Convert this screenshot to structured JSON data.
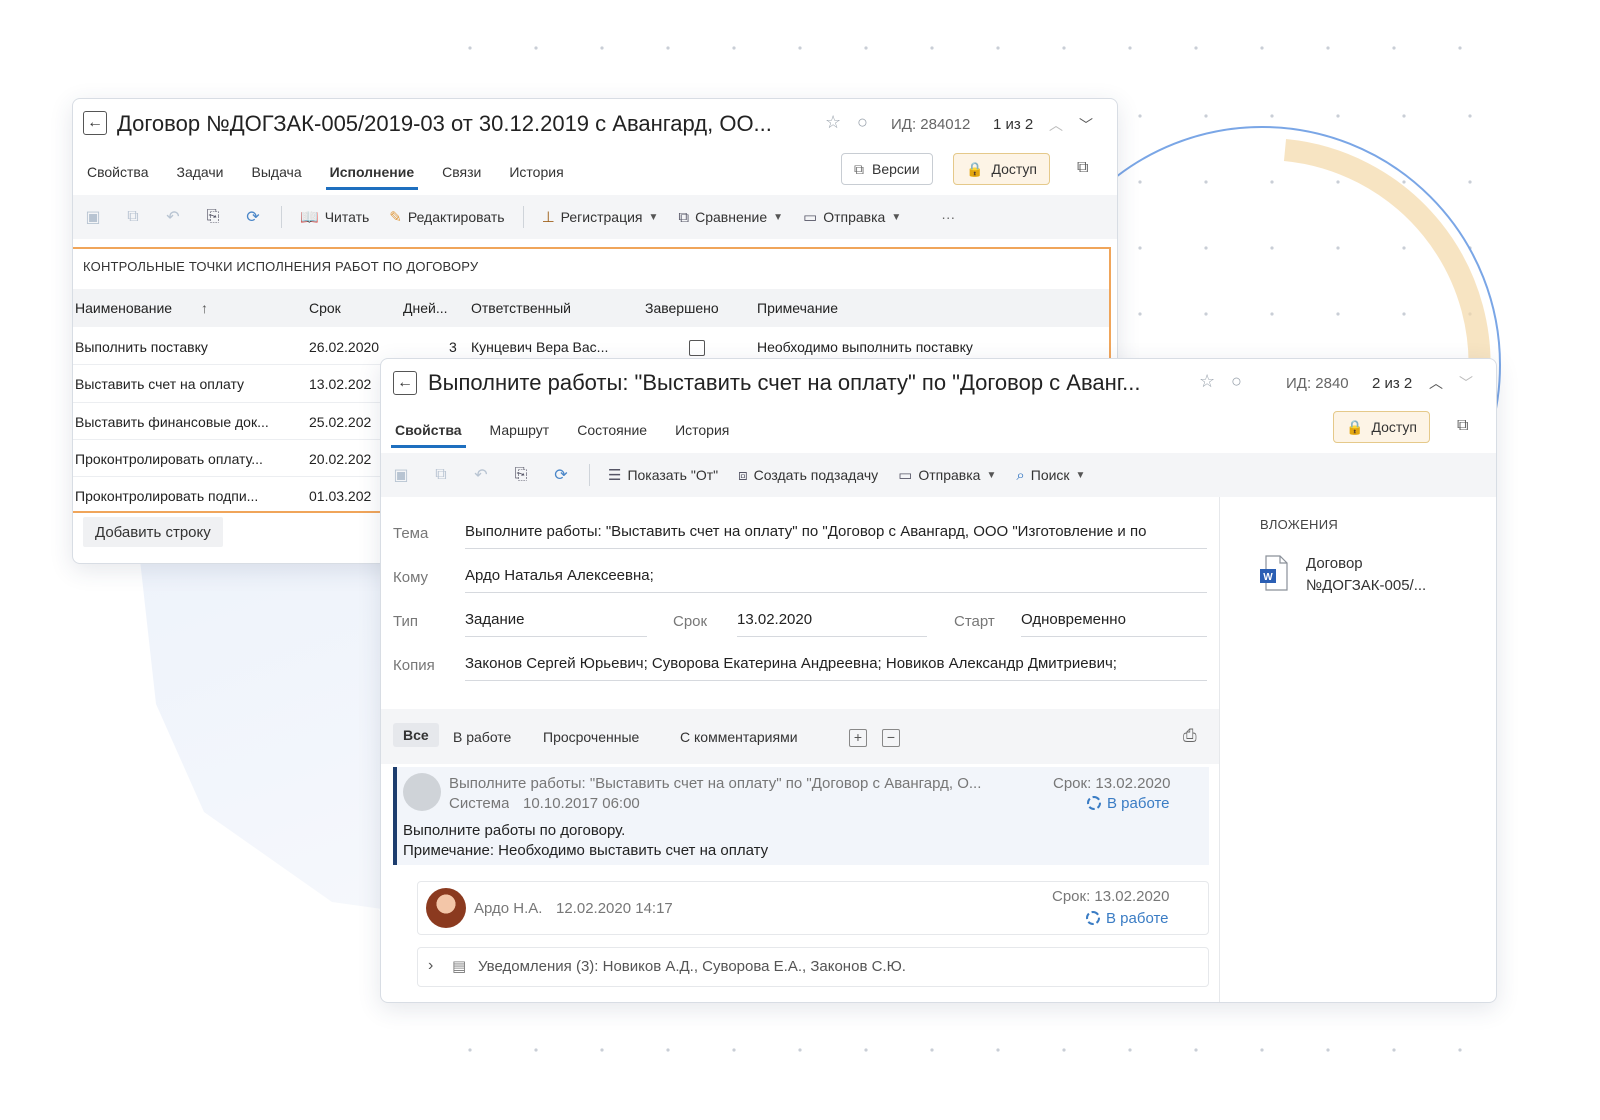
{
  "win1": {
    "title": "Договор №ДОГЗАК-005/2019-03 от 30.12.2019 с Авангард, ОО...",
    "id_text": "ИД: 284012",
    "nav_text": "1 из 2",
    "tabs": [
      "Свойства",
      "Задачи",
      "Выдача",
      "Исполнение",
      "Связи",
      "История"
    ],
    "active_tab": "Исполнение",
    "btn_versions": "Версии",
    "btn_access": "Доступ",
    "toolbar": {
      "read": "Читать",
      "edit": "Редактировать",
      "registration": "Регистрация",
      "comparison": "Сравнение",
      "send": "Отправка",
      "more": "···"
    },
    "section_title": "КОНТРОЛЬНЫЕ ТОЧКИ ИСПОЛНЕНИЯ РАБОТ ПО ДОГОВОРУ",
    "columns": [
      "Наименование",
      "Срок",
      "Дней...",
      "Ответственный",
      "Завершено",
      "Примечание"
    ],
    "sort_indicator": "↑",
    "rows": [
      {
        "name": "Выполнить поставку",
        "date": "26.02.2020",
        "days": "3",
        "responsible": "Кунцевич Вера Вас...",
        "note": "Необходимо выполнить поставку"
      },
      {
        "name": "Выставить счет на оплату",
        "date": "13.02.202"
      },
      {
        "name": "Выставить финансовые док...",
        "date": "25.02.202"
      },
      {
        "name": "Проконтролировать оплату...",
        "date": "20.02.202"
      },
      {
        "name": "Проконтролировать подпи...",
        "date": "01.03.202"
      }
    ],
    "add_row": "Добавить строку"
  },
  "win2": {
    "title": "Выполните работы: \"Выставить счет на оплату\" по \"Договор с Аванг...",
    "id_text": "ИД: 2840",
    "nav_text": "2 из 2",
    "tabs": [
      "Свойства",
      "Маршрут",
      "Состояние",
      "История"
    ],
    "active_tab": "Свойства",
    "btn_access": "Доступ",
    "toolbar": {
      "show_from": "Показать \"От\"",
      "create_subtask": "Создать подзадачу",
      "send": "Отправка",
      "search": "Поиск"
    },
    "fields": {
      "subject_label": "Тема",
      "subject_value": "Выполните работы: \"Выставить счет на оплату\" по \"Договор с Авангард, ООО \"Изготовление и по",
      "to_label": "Кому",
      "to_value": "Ардо Наталья Алексеевна;",
      "type_label": "Тип",
      "type_value": "Задание",
      "due_label": "Срок",
      "due_value": "13.02.2020",
      "start_label": "Старт",
      "start_value": "Одновременно",
      "copy_label": "Копия",
      "copy_value": "Законов Сергей Юрьевич;  Суворова Екатерина Андреевна;  Новиков Александр Дмитриевич;"
    },
    "attachments": {
      "title": "ВЛОЖЕНИЯ",
      "item_line1": "Договор",
      "item_line2": "№ДОГЗАК-005/..."
    },
    "feed_tabs": [
      "Все",
      "В работе",
      "Просроченные",
      "С комментариями"
    ],
    "feed_active": "Все",
    "messages": [
      {
        "title": "Выполните работы: \"Выставить счет на оплату\" по \"Договор с Авангард, О...",
        "author": "Система",
        "time": "10.10.2017 06:00",
        "due": "Срок: 13.02.2020",
        "status": "В работе",
        "body1": "Выполните работы по договору.",
        "body2": "Примечание: Необходимо выставить счет на оплату"
      },
      {
        "author": "Ардо Н.А.",
        "time": "12.02.2020 14:17",
        "due": "Срок: 13.02.2020",
        "status": "В работе"
      }
    ],
    "notifications": "Уведомления (3): Новиков А.Д., Суворова Е.А., Законов С.Ю."
  },
  "colors": {
    "accent_blue": "#1e6fbf",
    "orange_frame": "#f0a55a",
    "access_bg": "#fdf4e6",
    "dark_bar": "#1d3d6e"
  }
}
